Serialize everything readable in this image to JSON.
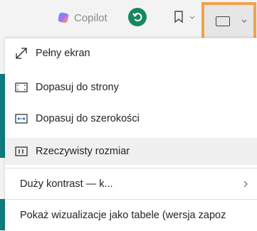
{
  "toolbar": {
    "copilot_label": "Copilot"
  },
  "menu": {
    "items": [
      {
        "label": "Pełny ekran",
        "icon": "fullscreen-icon"
      },
      {
        "label": "Dopasuj do strony",
        "icon": "fit-page-icon"
      },
      {
        "label": "Dopasuj do szerokości",
        "icon": "fit-width-icon"
      },
      {
        "label": "Rzeczywisty rozmiar",
        "icon": "actual-size-icon",
        "selected": true
      },
      {
        "label": "Duży kontrast — k...",
        "has_submenu": true
      },
      {
        "label": "Pokaż wizualizacje jako tabele (wersja zapoz"
      }
    ]
  },
  "colors": {
    "accent": "#0f7b7b",
    "highlight_border": "#f0a24c",
    "sync_button": "#16875f"
  }
}
